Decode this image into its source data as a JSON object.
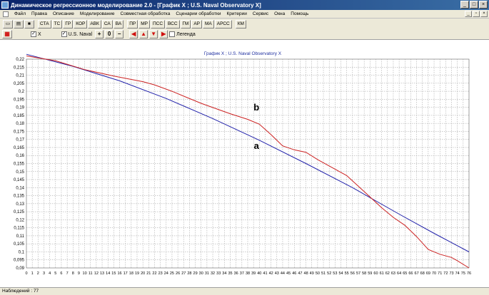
{
  "window": {
    "title": "Динамическое регрессионное моделирование 2.0 - [График X ; U.S. Naval Observatory X]"
  },
  "menu": [
    "Файл",
    "Правка",
    "Описание",
    "Моделирование",
    "Совместная обработка",
    "Сценарии обработки",
    "Критерии",
    "Сервис",
    "Окна",
    "Помощь"
  ],
  "toolbar": {
    "buttons": [
      "СТА",
      "ТС",
      "ГР",
      "КОР",
      "АВК",
      "СА",
      "ВА",
      "ПР",
      "МР",
      "ПСС",
      "ВСС",
      "ГМ",
      "АР",
      "МА",
      "АРСС",
      "КМ"
    ]
  },
  "selection": {
    "series1_label": "X",
    "series2_label": "U.S. Naval",
    "legend_label": "Легенда",
    "zoom_in": "+",
    "zoom_reset": "0",
    "zoom_out": "−"
  },
  "chart_data": {
    "type": "line",
    "title": "График X ; U.S. Naval Observatory X",
    "xlabel": "",
    "ylabel": "",
    "xlim": [
      0,
      76
    ],
    "ylim": [
      0.09,
      0.22
    ],
    "y_ticks": [
      "0,09",
      "0,095",
      "0,1",
      "0,105",
      "0,11",
      "0,115",
      "0,12",
      "0,125",
      "0,13",
      "0,135",
      "0,14",
      "0,145",
      "0,15",
      "0,155",
      "0,16",
      "0,165",
      "0,17",
      "0,175",
      "0,18",
      "0,185",
      "0,19",
      "0,195",
      "0,2",
      "0,205",
      "0,21",
      "0,215",
      "0,22"
    ],
    "grid": true,
    "annotations": [
      {
        "text": "b",
        "x": 39.5,
        "y": 0.188
      },
      {
        "text": "a",
        "x": 39.5,
        "y": 0.164
      }
    ],
    "series": [
      {
        "color": "#2222aa",
        "x": [
          0,
          8,
          16,
          24,
          32,
          40,
          48,
          56,
          64,
          70,
          76
        ],
        "y": [
          0.223,
          0.2155,
          0.2065,
          0.1955,
          0.183,
          0.1695,
          0.155,
          0.14,
          0.1235,
          0.1115,
          0.1
        ]
      },
      {
        "color": "#cc2222",
        "x": [
          0,
          5,
          10,
          15,
          20,
          22,
          25,
          30,
          35,
          38,
          40,
          42,
          44,
          46,
          48,
          50,
          52,
          55,
          58,
          61,
          63,
          65,
          67,
          69,
          71,
          73,
          74,
          76
        ],
        "y": [
          0.222,
          0.219,
          0.2135,
          0.2095,
          0.206,
          0.204,
          0.2,
          0.1925,
          0.186,
          0.1825,
          0.1795,
          0.173,
          0.166,
          0.1635,
          0.162,
          0.1575,
          0.1535,
          0.1475,
          0.1375,
          0.1275,
          0.1215,
          0.1165,
          0.1095,
          0.1015,
          0.0985,
          0.0965,
          0.0945,
          0.09
        ]
      }
    ]
  },
  "status": {
    "text": "Наблюдений : 77"
  }
}
